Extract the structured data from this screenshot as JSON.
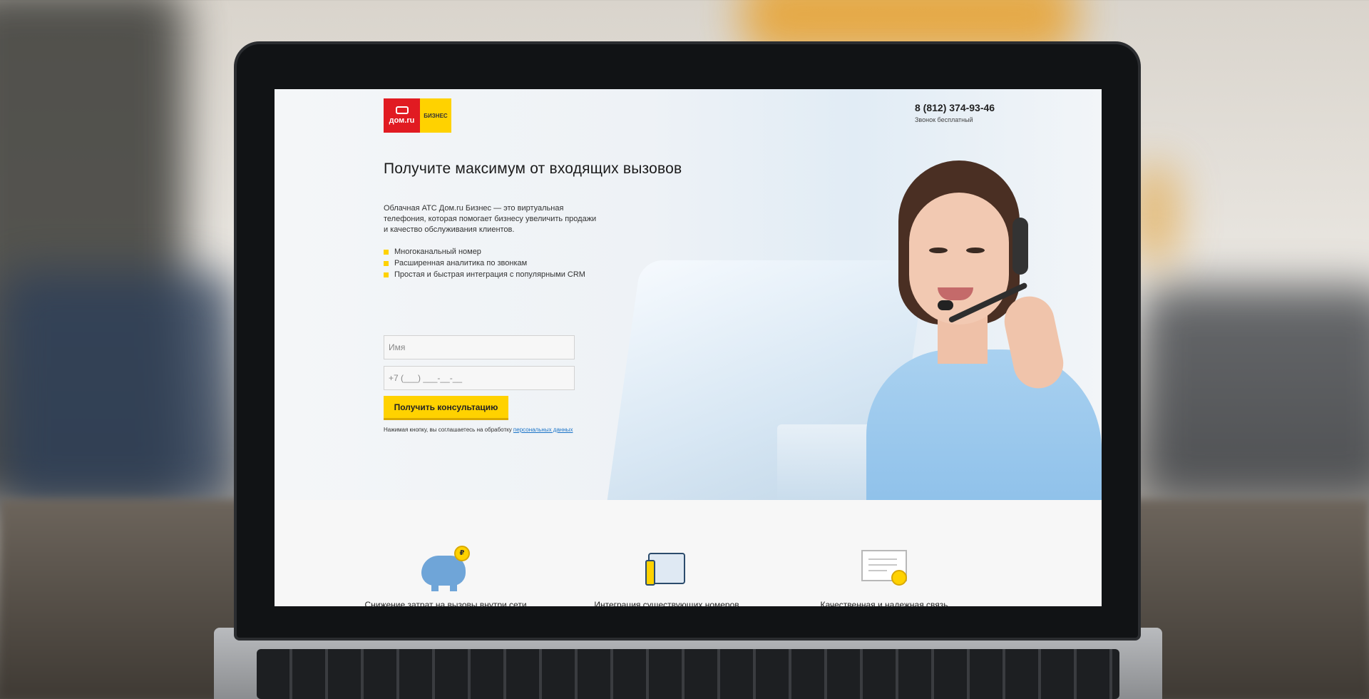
{
  "header": {
    "logo_main": "дом.ru",
    "logo_sub": "БИЗНЕС",
    "phone_number": "8 (812) 374-93-46",
    "phone_note": "Звонок бесплатный"
  },
  "hero": {
    "headline": "Получите максимум от входящих вызовов",
    "description": "Облачная АТС Дом.ru Бизнес — это виртуальная телефония, которая помогает бизнесу увеличить продажи и качество обслуживания клиентов.",
    "features": [
      "Многоканальный номер",
      "Расширенная аналитика по звонкам",
      "Простая и быстрая интеграция с популярными CRM"
    ]
  },
  "form": {
    "name_placeholder": "Имя",
    "phone_placeholder": "+7 (___) ___-__-__",
    "submit_label": "Получить консультацию",
    "consent_text": "Нажимая кнопку, вы соглашаетесь на обработку ",
    "consent_link": "персональных данных"
  },
  "benefits": [
    {
      "label": "Снижение затрат на вызовы внутри сети",
      "icon": "piggy-bank-icon"
    },
    {
      "label": "Интеграция существующих номеров",
      "icon": "office-phone-icon"
    },
    {
      "label": "Качественная и надежная связь",
      "icon": "certificate-icon"
    }
  ],
  "colors": {
    "brand_red": "#e11b22",
    "brand_yellow": "#ffd200",
    "link_blue": "#1a73c7"
  }
}
